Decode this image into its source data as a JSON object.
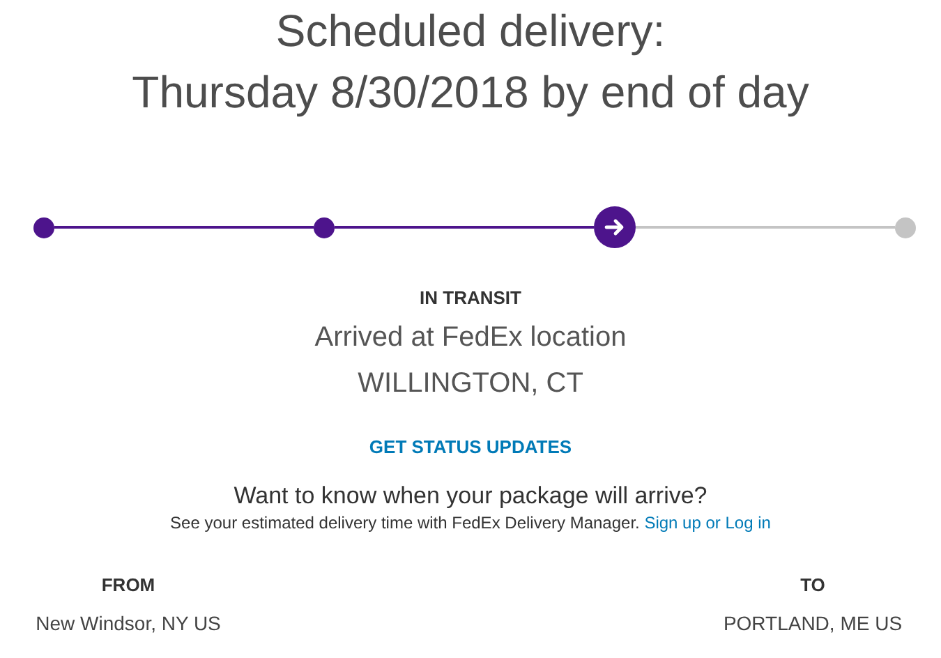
{
  "heading": [
    "Scheduled delivery:",
    "Thursday 8/30/2018 by end of day"
  ],
  "progress": [
    {
      "kind": "complete"
    },
    {
      "kind": "complete"
    },
    {
      "kind": "current"
    },
    {
      "kind": "pending"
    }
  ],
  "status": {
    "label": "IN TRANSIT",
    "event": "Arrived at FedEx location",
    "location": "WILLINGTON, CT"
  },
  "status_link": "GET STATUS UPDATES",
  "promo": {
    "title": "Want to know when your package will arrive?",
    "text": "See your estimated delivery time with FedEx Delivery Manager.",
    "link": "Sign up or Log in"
  },
  "route": [
    {
      "label": "FROM",
      "place": "New Windsor, NY US"
    },
    {
      "label": "TO",
      "place": "PORTLAND, ME US"
    }
  ]
}
